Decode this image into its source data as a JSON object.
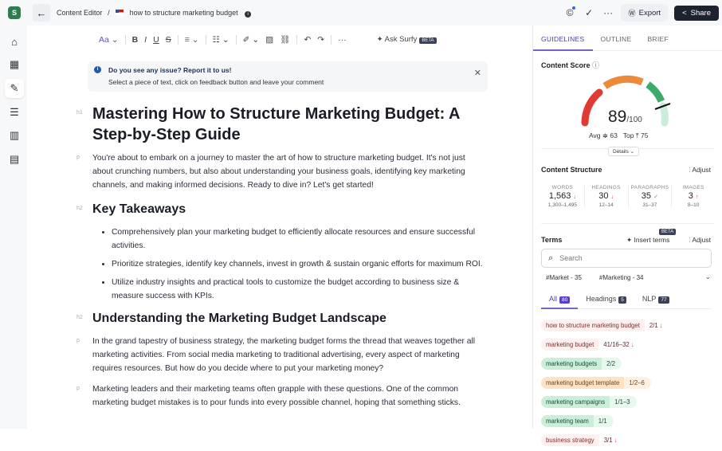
{
  "app": {
    "logo_letter": "S"
  },
  "header": {
    "breadcrumb_root": "Content Editor",
    "separator": "/",
    "doc_title": "how to structure marketing budget",
    "export_label": "Export",
    "share_label": "Share"
  },
  "toolbar": {
    "text_style": "Aa",
    "bold": "B",
    "italic": "I",
    "underline": "U",
    "strike": "S",
    "more": "···",
    "ask_label": "Ask Surfy",
    "ask_badge": "BETA"
  },
  "notice": {
    "title": "Do you see any issue? Report it to us!",
    "body": "Select a piece of text, click on feedback button and leave your comment"
  },
  "document": {
    "h1_tag": "h1",
    "h1": "Mastering How to Structure Marketing Budget: A Step-by-Step Guide",
    "p1": "You're about to embark on a journey to master the art of how to structure marketing budget. It's not just about crunching numbers, but also about understanding your business goals, identifying key marketing channels, and making informed decisions. Ready to dive in? Let's get started!",
    "h2a": "Key Takeaways",
    "bullets": [
      "Comprehensively plan your marketing budget to efficiently allocate resources and ensure successful activities.",
      "Prioritize strategies, identify key channels, invest in growth & sustain organic efforts for maximum ROI.",
      "Utilize industry insights and practical tools to customize the budget according to business size & measure success with KPIs."
    ],
    "h2b": "Understanding the Marketing Budget Landscape",
    "p2": "In the grand tapestry of business strategy, the marketing budget forms the thread that weaves together all marketing activities. From social media marketing to traditional advertising, every aspect of marketing requires resources. But how do you decide where to put your marketing money?",
    "p3": "Marketing leaders and their marketing teams often grapple with these questions. One of the common marketing budget mistakes is to pour funds into every possible channel, hoping that something sticks.",
    "tag_p": "p",
    "tag_h2": "h2"
  },
  "panel": {
    "tabs": [
      "GUIDELINES",
      "OUTLINE",
      "BRIEF"
    ],
    "score": {
      "title": "Content Score",
      "value": "89",
      "max": "/100",
      "fraction": 0.89,
      "avg_label": "Avg",
      "avg": "63",
      "top_label": "Top",
      "top": "75",
      "details": "Details"
    },
    "structure": {
      "title": "Content Structure",
      "adjust": "Adjust",
      "items": [
        {
          "label": "WORDS",
          "value": "1,563",
          "trend": "↓",
          "range": "1,300–1,495"
        },
        {
          "label": "HEADINGS",
          "value": "30",
          "trend": "↓",
          "range": "12–14"
        },
        {
          "label": "PARAGRAPHS",
          "value": "35",
          "trend": "✓",
          "range": "31–37"
        },
        {
          "label": "IMAGES",
          "value": "3",
          "trend": "↑",
          "range": "8–10"
        }
      ]
    },
    "terms": {
      "title": "Terms",
      "insert": "Insert terms",
      "insert_badge": "BETA",
      "adjust": "Adjust",
      "search_placeholder": "Search",
      "tags": [
        "#Market - 35",
        "#Marketing - 34"
      ],
      "tabs": [
        {
          "label": "All",
          "count": "80"
        },
        {
          "label": "Headings",
          "count": "5"
        },
        {
          "label": "NLP",
          "count": "77"
        }
      ],
      "list": [
        {
          "term": "how to structure marketing budget",
          "count": "2/1",
          "state": "over",
          "arrow": "↓"
        },
        {
          "term": "marketing budget",
          "count": "41/16–32",
          "state": "over",
          "arrow": "↓"
        },
        {
          "term": "marketing budgets",
          "count": "2/2",
          "state": "ok",
          "arrow": ""
        },
        {
          "term": "marketing budget template",
          "count": "1/2–6",
          "state": "low",
          "arrow": ""
        },
        {
          "term": "marketing campaigns",
          "count": "1/1–3",
          "state": "ok",
          "arrow": ""
        },
        {
          "term": "marketing team",
          "count": "1/1",
          "state": "ok",
          "arrow": ""
        },
        {
          "term": "business strategy",
          "count": "3/1",
          "state": "over",
          "arrow": "↓"
        }
      ]
    }
  }
}
